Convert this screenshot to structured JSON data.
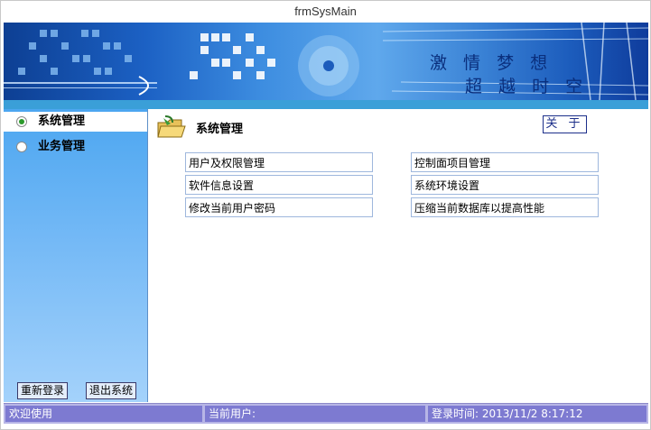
{
  "window": {
    "title": "frmSysMain"
  },
  "banner": {
    "slogan_line1": "激 情 梦 想",
    "slogan_line2": "超 越 时 空"
  },
  "sidebar": {
    "items": [
      {
        "label": "系统管理",
        "selected": true
      },
      {
        "label": "业务管理",
        "selected": false
      }
    ],
    "relogin_label": "重新登录",
    "exit_label": "退出系统"
  },
  "main": {
    "title": "系统管理",
    "about_label": "关 于",
    "menu_left": [
      "用户及权限管理",
      "软件信息设置",
      "修改当前用户密码"
    ],
    "menu_right": [
      "控制面项目管理",
      "系统环境设置",
      "压缩当前数据库以提高性能"
    ]
  },
  "status": {
    "welcome": "欢迎使用",
    "current_user": "当前用户:",
    "login_time": "登录时间: 2013/11/2 8:17:12"
  },
  "colors": {
    "banner_dark": "#0d3f93",
    "sidebar": "#74b9f6",
    "statusbar": "#7d7ad1",
    "stripe": "#3a9fd8"
  }
}
